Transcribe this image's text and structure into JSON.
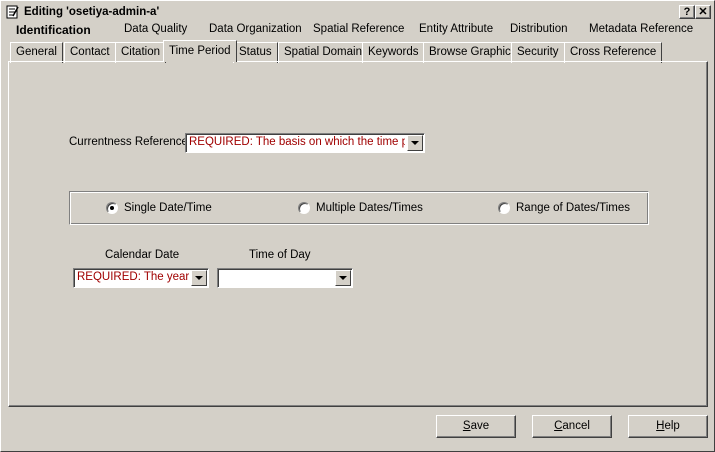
{
  "window": {
    "title": "Editing 'osetiya-admin-a'",
    "help_button": "?",
    "close_button": "✕"
  },
  "main_tabs": [
    {
      "label": "Identification",
      "active": true
    },
    {
      "label": "Data Quality"
    },
    {
      "label": "Data Organization"
    },
    {
      "label": "Spatial Reference"
    },
    {
      "label": "Entity Attribute"
    },
    {
      "label": "Distribution"
    },
    {
      "label": "Metadata Reference"
    }
  ],
  "sub_tabs": [
    {
      "label": "General"
    },
    {
      "label": "Contact"
    },
    {
      "label": "Citation"
    },
    {
      "label": "Time Period",
      "active": true
    },
    {
      "label": "Status"
    },
    {
      "label": "Spatial Domain"
    },
    {
      "label": "Keywords"
    },
    {
      "label": "Browse Graphic"
    },
    {
      "label": "Security"
    },
    {
      "label": "Cross Reference"
    }
  ],
  "form": {
    "currentness_label": "Currentness Reference:",
    "currentness_value": "REQUIRED: The basis on which the time peri",
    "date_mode": {
      "options": [
        {
          "label": "Single Date/Time",
          "selected": true
        },
        {
          "label": "Multiple Dates/Times",
          "selected": false
        },
        {
          "label": "Range of Dates/Times",
          "selected": false
        }
      ]
    },
    "calendar_date_label": "Calendar Date",
    "calendar_date_value": "REQUIRED: The year (",
    "time_of_day_label": "Time of Day",
    "time_of_day_value": ""
  },
  "buttons": {
    "save": {
      "mnemonic": "S",
      "rest": "ave"
    },
    "cancel": {
      "mnemonic": "C",
      "rest": "ancel"
    },
    "help": {
      "mnemonic": "H",
      "rest": "elp"
    }
  },
  "colors": {
    "face": "#d4d0c8",
    "required_text": "#a00000"
  }
}
